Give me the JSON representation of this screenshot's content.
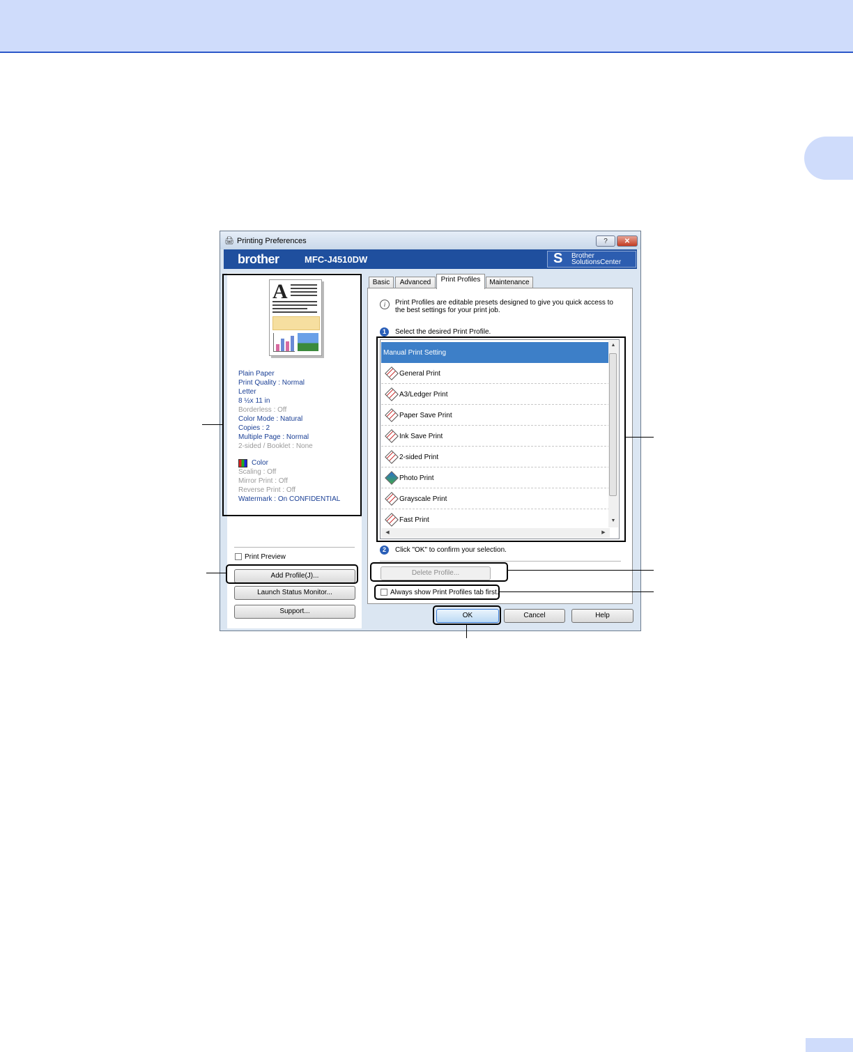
{
  "window": {
    "title": "Printing Preferences",
    "help_label": "?",
    "close_label": "✕"
  },
  "banner": {
    "brand": "brother",
    "model": "MFC-J4510DW",
    "solutions_center": "Brother SolutionsCenter"
  },
  "summary": {
    "lines": [
      {
        "text": "Plain Paper",
        "active": true
      },
      {
        "text": "Print Quality : Normal",
        "active": true
      },
      {
        "text": "Letter",
        "active": true
      },
      {
        "text": "8 ½x 11 in",
        "active": true
      },
      {
        "text": "Borderless : Off",
        "active": false
      },
      {
        "text": "Color Mode : Natural",
        "active": true
      },
      {
        "text": "Copies : 2",
        "active": true
      },
      {
        "text": "Multiple Page : Normal",
        "active": true
      },
      {
        "text": "2-sided / Booklet : None",
        "active": false
      }
    ],
    "color_label": "Color",
    "lines2": [
      {
        "text": "Scaling : Off",
        "active": false
      },
      {
        "text": "Mirror Print : Off",
        "active": false
      },
      {
        "text": "Reverse Print : Off",
        "active": false
      },
      {
        "text": "Watermark : On  CONFIDENTIAL",
        "active": true
      }
    ]
  },
  "left_controls": {
    "print_preview_label": "Print Preview",
    "print_preview_checked": false,
    "add_profile": "Add Profile(J)...",
    "launch_status_monitor": "Launch Status Monitor...",
    "support": "Support..."
  },
  "tabs": [
    {
      "label": "Basic",
      "active": false
    },
    {
      "label": "Advanced",
      "active": false
    },
    {
      "label": "Print Profiles",
      "active": true
    },
    {
      "label": "Maintenance",
      "active": false
    }
  ],
  "print_profiles": {
    "info": "Print Profiles are editable presets designed to give you quick access to the best settings for your print job.",
    "step1_num": "1",
    "step1": "Select the desired Print Profile.",
    "profiles": [
      {
        "label": "Manual Print Setting",
        "selected": true,
        "icon": "none"
      },
      {
        "label": "General Print",
        "selected": false,
        "icon": "profile-icon"
      },
      {
        "label": "A3/Ledger Print",
        "selected": false,
        "icon": "profile-icon"
      },
      {
        "label": "Paper Save Print",
        "selected": false,
        "icon": "profile-icon"
      },
      {
        "label": "Ink Save Print",
        "selected": false,
        "icon": "profile-icon"
      },
      {
        "label": "2-sided Print",
        "selected": false,
        "icon": "profile-icon"
      },
      {
        "label": "Photo Print",
        "selected": false,
        "icon": "photo-icon"
      },
      {
        "label": "Grayscale Print",
        "selected": false,
        "icon": "profile-icon"
      },
      {
        "label": "Fast Print",
        "selected": false,
        "icon": "profile-icon"
      }
    ],
    "step2_num": "2",
    "step2": "Click \"OK\" to confirm your selection.",
    "delete_profile": "Delete Profile...",
    "always_show": "Always show Print Profiles tab first.",
    "always_show_checked": false
  },
  "footer": {
    "ok": "OK",
    "cancel": "Cancel",
    "help": "Help"
  },
  "colors": {
    "banner": "#1f4f9e",
    "selected_row": "#3d7fc8",
    "page_band": "#cfdcfb",
    "summary_text": "#1a3f95"
  }
}
